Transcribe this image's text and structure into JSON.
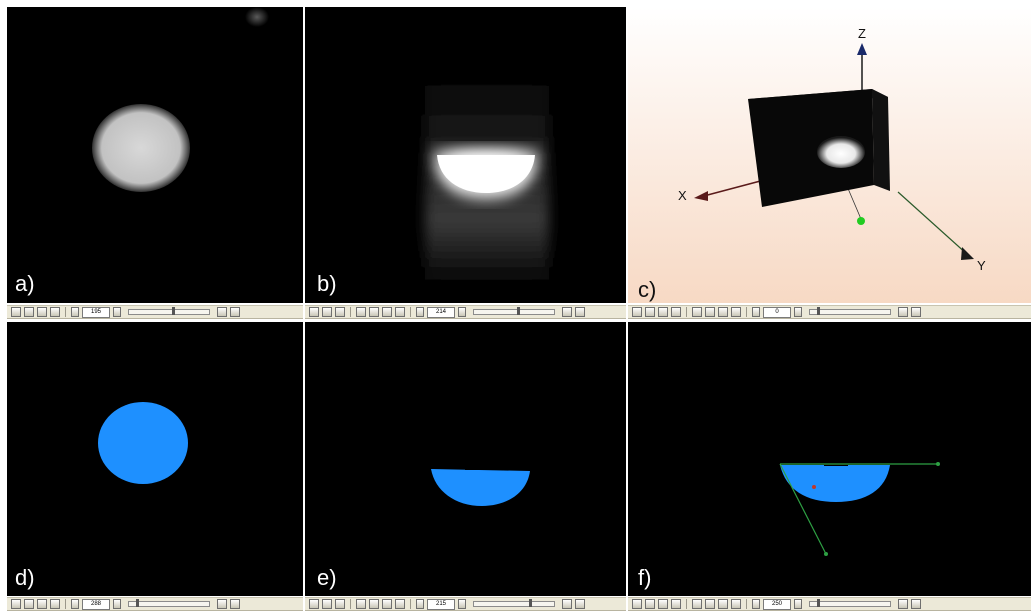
{
  "panels": {
    "a": {
      "label": "a)"
    },
    "b": {
      "label": "b)"
    },
    "c": {
      "label": "c)",
      "axis_z": "Z",
      "axis_x": "X",
      "axis_y": "Y"
    },
    "d": {
      "label": "d)"
    },
    "e": {
      "label": "e)"
    },
    "f": {
      "label": "f)"
    }
  },
  "toolbars": {
    "a": {
      "slice_value": "195",
      "slider_level": 0.55
    },
    "b": {
      "slice_value": "214",
      "slider_level": 0.55
    },
    "c": {
      "slice_value": "0",
      "slider_level": 0.1
    },
    "d": {
      "slice_value": "288",
      "slider_level": 0.1
    },
    "e": {
      "slice_value": "215",
      "slider_level": 0.7
    },
    "f": {
      "slice_value": "250",
      "slider_level": 0.1
    }
  },
  "colors": {
    "segmentation_blue": "#1e90ff",
    "axis_line": "#1a1a1a",
    "vector_green": "#2ea043",
    "panel_c_top": "#ffffff",
    "panel_c_bottom": "#f7d9c4"
  }
}
